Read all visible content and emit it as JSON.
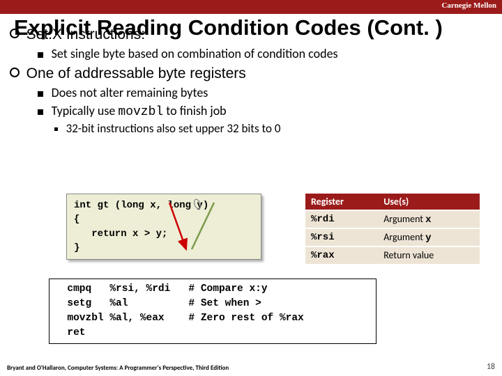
{
  "brand": "Carnegie Mellon",
  "title": "Explicit Reading Condition Codes (Cont. )",
  "b1a": "Set.X Instructions:",
  "b2a": "Set single byte based on combination of condition codes",
  "b1b": "One of addressable byte registers",
  "b2b": "Does not alter remaining bytes",
  "b2c_pre": "Typically use ",
  "b2c_code": "movzbl",
  "b2c_post": " to finish job",
  "b3a": "32-bit instructions also set upper 32 bits to 0",
  "code_line1": "int gt (long x, long y)",
  "code_line2": "{",
  "code_line3": "   return x > y;",
  "code_line4": "}",
  "asm_text": "  cmpq   %rsi, %rdi   # Compare x:y\n  setg   %al          # Set when >\n  movzbl %al, %eax    # Zero rest of %rax\n  ret",
  "table": {
    "h1": "Register",
    "h2": "Use(s)",
    "rows": [
      {
        "reg": "%rdi",
        "use_pre": "Argument ",
        "use_var": "x"
      },
      {
        "reg": "%rsi",
        "use_pre": "Argument ",
        "use_var": "y"
      },
      {
        "reg": "%rax",
        "use_pre": "Return value",
        "use_var": ""
      }
    ]
  },
  "footer": "Bryant and O'Hallaron, Computer Systems: A Programmer's Perspective, Third Edition",
  "pagenum": "18"
}
